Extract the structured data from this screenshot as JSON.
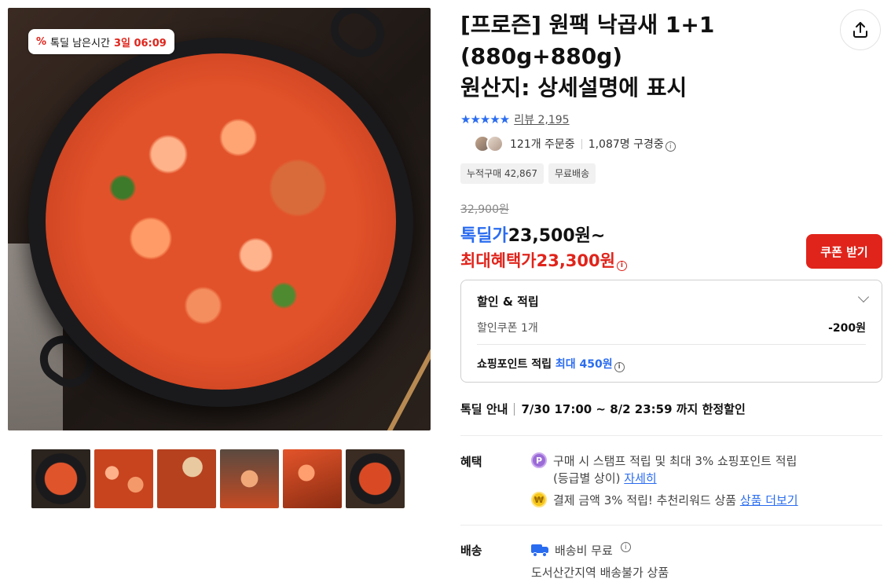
{
  "colors": {
    "accent_blue": "#2a6cf0",
    "accent_red": "#e0241b"
  },
  "badge": {
    "label": "톡딜 남은시간",
    "time": "3일 06:09",
    "icon": "todeal-icon"
  },
  "product": {
    "title_line1": "[프로즌] 원팩 낙곱새 1+1",
    "title_line2": "(880g+880g)",
    "title_line3": "원산지: 상세설명에 표시"
  },
  "rating": {
    "stars": "★★★★★",
    "review": "리뷰 2,195"
  },
  "buyers": {
    "ordering": "121개 주문중",
    "buying": "1,087명 구경중"
  },
  "tags": [
    "누적구매 42,867",
    "무료배송"
  ],
  "price": {
    "original": "32,900원",
    "deal_label": "톡딜가",
    "deal_value": "23,500원~",
    "max_label": "최대혜택가",
    "max_value": "23,300원"
  },
  "coupon_button": "쿠폰 받기",
  "benefit_box": {
    "header": "할인 & 적립",
    "coupon_label": "할인쿠폰 1개",
    "coupon_amount": "-200원",
    "point_label": "쇼핑포인트 적립",
    "point_value": "최대 450원"
  },
  "deal_info": {
    "label": "톡딜 안내",
    "text": "7/30 17:00 ~ 8/2 23:59 까지 한정할인"
  },
  "benefits": {
    "label": "혜택",
    "line1": "구매 시 스탬프 적립 및 최대 3% 쇼핑포인트 적립",
    "line2_prefix": "(등급별 상이)",
    "line2_link": "자세히",
    "line3_prefix": "결제 금액 3% 적립! 추천리워드 상품",
    "line3_link": "상품 더보기",
    "coin_p": "P",
    "coin_y": "₩"
  },
  "shipping": {
    "label": "배송",
    "fee": "배송비 무료",
    "note": "도서산간지역 배송불가 상품"
  }
}
